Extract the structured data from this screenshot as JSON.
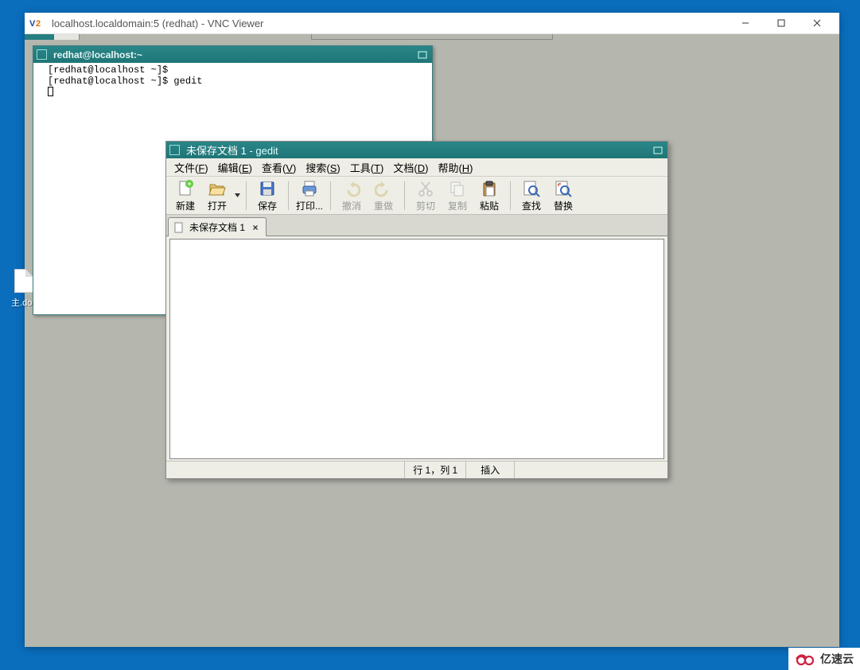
{
  "vnc": {
    "title": "localhost.localdomain:5 (redhat) - VNC Viewer"
  },
  "terminal": {
    "title": "redhat@localhost:~",
    "line1": "[redhat@localhost ~]$",
    "line2": "[redhat@localhost ~]$ gedit"
  },
  "desktop": {
    "file_label": "主.doc"
  },
  "gedit": {
    "title_prefix": "未保存文档 1",
    "title_suffix": " - gedit",
    "menu": {
      "file": {
        "label": "文件(",
        "key": "F",
        "suffix": ")"
      },
      "edit": {
        "label": "编辑(",
        "key": "E",
        "suffix": ")"
      },
      "view": {
        "label": "查看(",
        "key": "V",
        "suffix": ")"
      },
      "search": {
        "label": "搜索(",
        "key": "S",
        "suffix": ")"
      },
      "tools": {
        "label": "工具(",
        "key": "T",
        "suffix": ")"
      },
      "documents": {
        "label": "文档(",
        "key": "D",
        "suffix": ")"
      },
      "help": {
        "label": "帮助(",
        "key": "H",
        "suffix": ")"
      }
    },
    "toolbar": {
      "new": "新建",
      "open": "打开",
      "save": "保存",
      "print": "打印...",
      "undo": "撤消",
      "redo": "重做",
      "cut": "剪切",
      "copy": "复制",
      "paste": "粘贴",
      "find": "查找",
      "replace": "替换"
    },
    "tab": {
      "label": "未保存文档 1"
    },
    "status": {
      "cursor": "行 1，列 1",
      "insert": "插入"
    }
  },
  "watermark": "亿速云"
}
